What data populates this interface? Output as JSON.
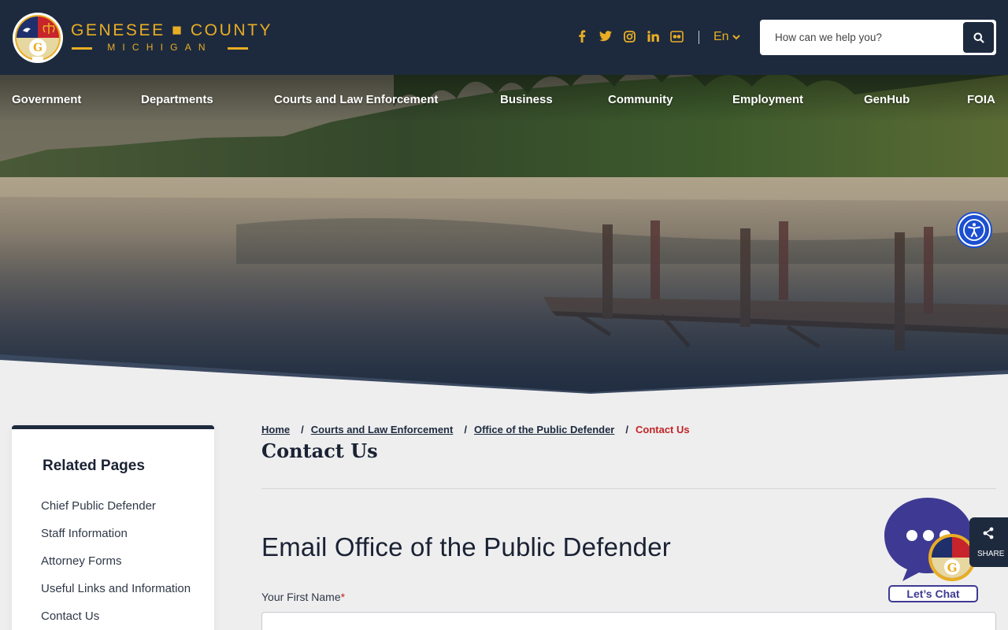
{
  "header": {
    "brand_top": "GENESEE ■ COUNTY",
    "brand_bottom": "MICHIGAN",
    "social": [
      {
        "icon": "facebook-icon",
        "glyph": "f"
      },
      {
        "icon": "twitter-icon",
        "glyph": "t"
      },
      {
        "icon": "instagram-icon",
        "glyph": "i"
      },
      {
        "icon": "linkedin-icon",
        "glyph": "in"
      },
      {
        "icon": "flickr-icon",
        "glyph": "fl"
      }
    ],
    "language": "En",
    "search_placeholder": "How can we help you?"
  },
  "nav": {
    "government": "Government",
    "departments": "Departments",
    "courts": "Courts and Law Enforcement",
    "business": "Business",
    "community": "Community",
    "employment": "Employment",
    "genhub": "GenHub",
    "foia": "FOIA"
  },
  "sidebar": {
    "title": "Related Pages",
    "items": [
      "Chief Public Defender",
      "Staff Information",
      "Attorney Forms",
      "Useful Links and Information",
      "Contact Us"
    ]
  },
  "breadcrumb": {
    "home": "Home",
    "courts": "Courts and Law Enforcement",
    "office": "Office of the Public Defender",
    "current": "Contact Us",
    "sep": "/"
  },
  "page": {
    "title": "Contact Us",
    "form_title": "Email Office of the Public Defender",
    "first_name_label": "Your First Name",
    "required_mark": "*"
  },
  "chat": {
    "label": "Let’s Chat"
  },
  "share": {
    "label": "SHARE"
  },
  "colors": {
    "navy": "#1d2a3e",
    "gold": "#e9ad24",
    "red": "#c22424",
    "access_blue": "#1c4fd0",
    "chat_purple": "#3e3a93"
  }
}
